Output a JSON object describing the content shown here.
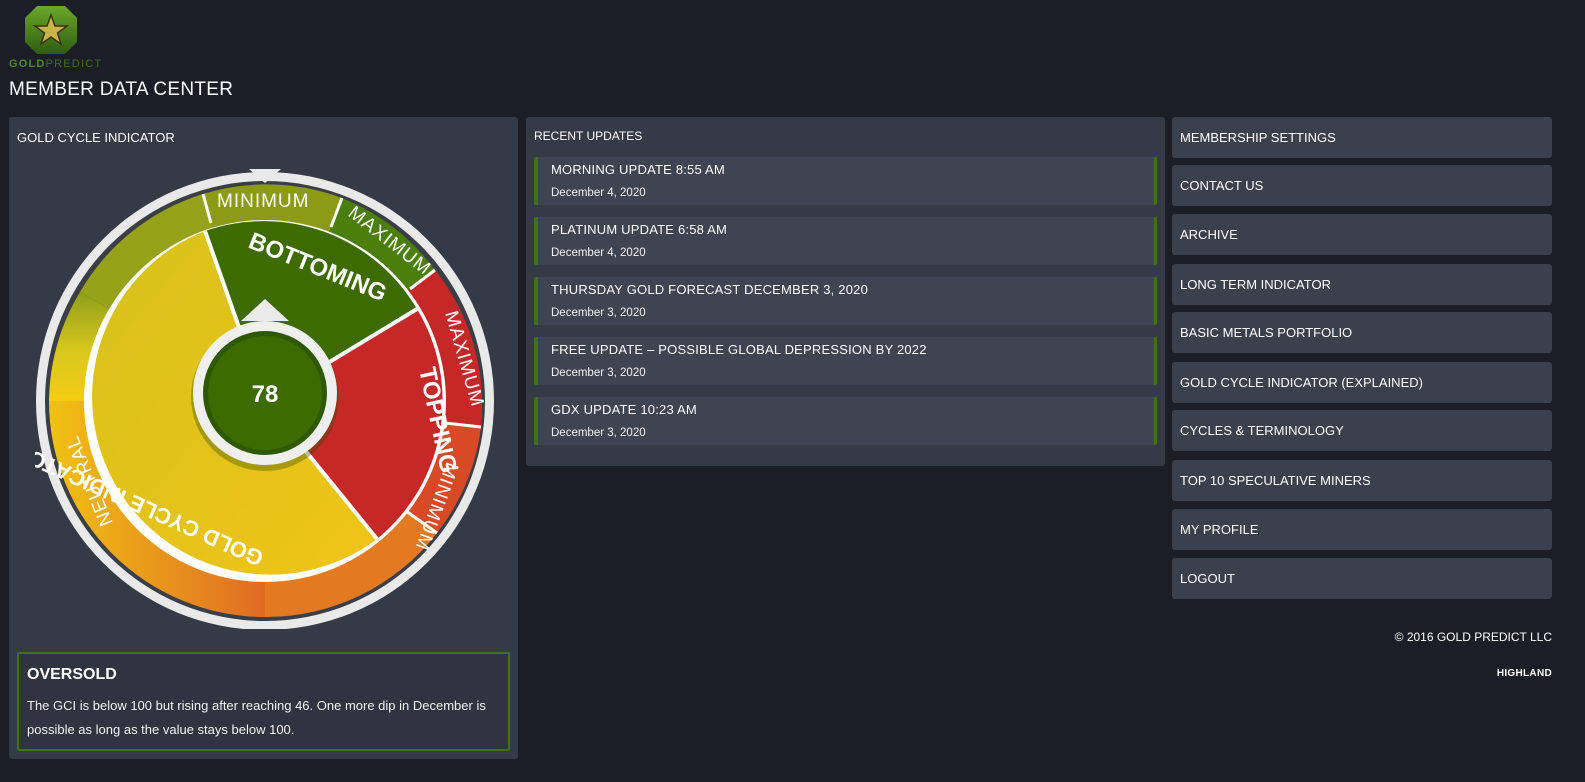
{
  "brand": {
    "name_part1": "GOLD",
    "name_part2": "PREDICT",
    "colors": {
      "green": "#4f8d1f",
      "dark_green": "#3e6e1c"
    }
  },
  "page": {
    "title": "MEMBER DATA CENTER"
  },
  "gci": {
    "title": "GOLD CYCLE INDICATOR",
    "value": "78",
    "gauge": {
      "inner_labels": [
        "BOTTOMING",
        "TOPPING",
        "GOLD CYCLE INDICATOR"
      ],
      "outer_labels": [
        "MINIMUM",
        "MAXIMUM",
        "MAXIMUM",
        "MINIMUM",
        "NEUTRAL"
      ],
      "colors": {
        "green": "#3d6b00",
        "red": "#c62828",
        "yellow": "#e6c21c",
        "olive": "#9aa51b",
        "orange": "#e07b22"
      }
    },
    "status": {
      "title": "OVERSOLD",
      "description": "The GCI is below 100 but rising after reaching 46. One more dip in December is possible as long as the value stays below 100."
    }
  },
  "updates": {
    "title": "RECENT UPDATES",
    "items": [
      {
        "title": "MORNING UPDATE 8:55 AM",
        "date": "December 4, 2020"
      },
      {
        "title": "PLATINUM UPDATE 6:58 AM",
        "date": "December 4, 2020"
      },
      {
        "title": "THURSDAY GOLD FORECAST DECEMBER 3, 2020",
        "date": "December 3, 2020"
      },
      {
        "title": "FREE UPDATE – POSSIBLE GLOBAL DEPRESSION BY 2022",
        "date": "December 3, 2020"
      },
      {
        "title": "GDX UPDATE 10:23 AM",
        "date": "December 3, 2020"
      }
    ]
  },
  "menu": {
    "items": [
      "MEMBERSHIP SETTINGS",
      "CONTACT US",
      "ARCHIVE",
      "LONG TERM INDICATOR",
      "BASIC METALS PORTFOLIO",
      "GOLD CYCLE INDICATOR (EXPLAINED)",
      "CYCLES & TERMINOLOGY",
      "TOP 10 SPECULATIVE MINERS",
      "MY PROFILE",
      "LOGOUT"
    ]
  },
  "footer": {
    "copyright": "© 2016 GOLD PREDICT LLC",
    "credit": "HIGHLAND"
  }
}
